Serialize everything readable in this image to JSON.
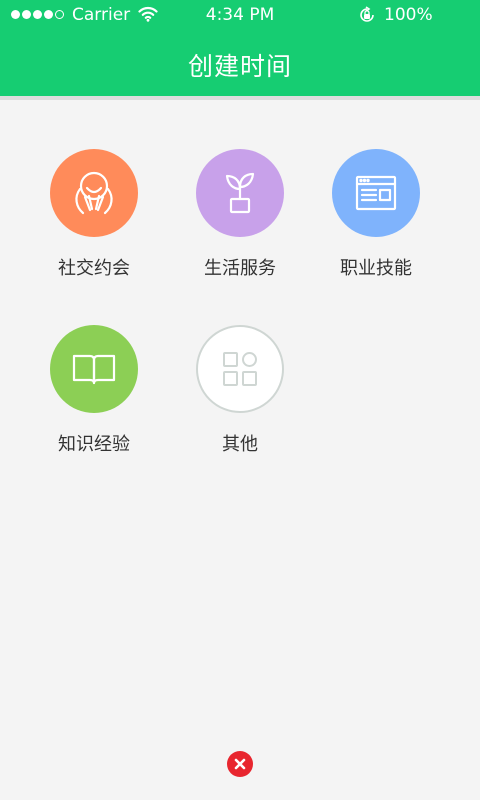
{
  "status_bar": {
    "carrier": "Carrier",
    "time": "4:34 PM",
    "battery": "100%"
  },
  "header": {
    "title": "创建时间",
    "color": "#16cd72"
  },
  "categories": [
    {
      "label": "社交约会",
      "icon": "hug-face-icon",
      "color": "#ff8b5a"
    },
    {
      "label": "生活服务",
      "icon": "plant-pot-icon",
      "color": "#c8a1ea"
    },
    {
      "label": "职业技能",
      "icon": "browser-window-icon",
      "color": "#7fb3fc"
    },
    {
      "label": "知识经验",
      "icon": "book-icon",
      "color": "#8ccf55"
    },
    {
      "label": "其他",
      "icon": "grid-icon",
      "color": "#ffffff"
    }
  ],
  "close": {
    "icon": "close-icon",
    "color": "#e8262f"
  }
}
